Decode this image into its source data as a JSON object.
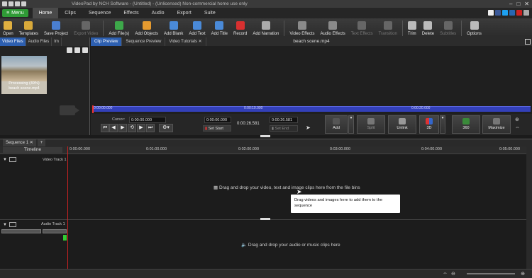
{
  "window": {
    "title": "VideoPad by NCH Software - (Untitled) - (Unlicensed) Non-commercial home use only",
    "controls": [
      "–",
      "□",
      "✕"
    ]
  },
  "ribbon": {
    "menu_label": "Menu",
    "tabs": [
      "Home",
      "Clips",
      "Sequence",
      "Effects",
      "Audio",
      "Export",
      "Suite"
    ],
    "active_tab": "Home"
  },
  "toolbar": {
    "items": [
      {
        "label": "Open",
        "icon": "folder-icon",
        "color": "#e0b040",
        "enabled": true
      },
      {
        "label": "Templates",
        "icon": "templates-icon",
        "color": "#d8a93a",
        "enabled": true
      },
      {
        "label": "Save Project",
        "icon": "save-icon",
        "color": "#4a7fd0",
        "enabled": true
      },
      {
        "label": "Export Video",
        "icon": "export-video-icon",
        "color": "#666666",
        "enabled": false
      },
      {
        "label": "Add File(s)",
        "icon": "add-file-icon",
        "color": "#3da84a",
        "enabled": true
      },
      {
        "label": "Add Objects",
        "icon": "add-objects-icon",
        "color": "#e59a2f",
        "enabled": true
      },
      {
        "label": "Add Blank",
        "icon": "add-blank-icon",
        "color": "#4a8ad8",
        "enabled": true
      },
      {
        "label": "Add Text",
        "icon": "add-text-icon",
        "color": "#4a8ad8",
        "enabled": true
      },
      {
        "label": "Add Title",
        "icon": "add-title-icon",
        "color": "#4a8ad8",
        "enabled": true
      },
      {
        "label": "Record",
        "icon": "record-icon",
        "color": "#d83030",
        "enabled": true
      },
      {
        "label": "Add Narration",
        "icon": "narration-icon",
        "color": "#aaaaaa",
        "enabled": true
      },
      {
        "label": "Video Effects",
        "icon": "video-effects-icon",
        "color": "#8a8a8a",
        "enabled": true
      },
      {
        "label": "Audio Effects",
        "icon": "audio-effects-icon",
        "color": "#8a8a8a",
        "enabled": true
      },
      {
        "label": "Text Effects",
        "icon": "text-effects-icon",
        "color": "#666666",
        "enabled": false
      },
      {
        "label": "Transition",
        "icon": "transition-icon",
        "color": "#666666",
        "enabled": false
      },
      {
        "label": "Trim",
        "icon": "trim-icon",
        "color": "#bbbbbb",
        "enabled": true
      },
      {
        "label": "Delete",
        "icon": "delete-icon",
        "color": "#bbbbbb",
        "enabled": true
      },
      {
        "label": "Subtitles",
        "icon": "subtitles-icon",
        "color": "#666666",
        "enabled": false
      },
      {
        "label": "Options",
        "icon": "options-icon",
        "color": "#bbbbbb",
        "enabled": true
      }
    ]
  },
  "bins": {
    "tabs": [
      "Video Files",
      "Audio Files",
      "Im"
    ],
    "active_tab": "Video Files",
    "clip": {
      "status": "Processing (49%)",
      "name": "beach scene.mp4"
    }
  },
  "preview": {
    "tabs": [
      "Clip Preview",
      "Sequence Preview",
      "Video Tutorials"
    ],
    "active_tab": "Clip Preview",
    "filename": "beach scene.mp4",
    "scrub_ticks": [
      "0:00:00.000",
      "0:00:10.000",
      "0:00:20.000"
    ],
    "cursor_label": "Cursor:",
    "cursor_value": "0:00:00.000",
    "start_value": "0:00:00.000",
    "duration": "0:00:26.581",
    "end_value": "0:00:26.581",
    "set_start": "Set Start",
    "set_end": "Set End",
    "buttons": [
      "Add",
      "Split",
      "Unlink",
      "3D",
      "360",
      "Maximize"
    ]
  },
  "sequence": {
    "tab": "Sequence 1",
    "timeline_label": "Timeline",
    "ruler_ticks": [
      "0:00:00.000",
      "0:01:00.000",
      "0:02:00.000",
      "0:03:00.000",
      "0:04:00.000",
      "0:05:00.000"
    ],
    "video_track": "Video Track 1",
    "audio_track": "Audio Track 1",
    "video_hint": "Drag and drop your video, text and image clips here from the file bins",
    "audio_hint": "Drag and drop your audio or music clips here",
    "tooltip": "Drag videos and images here to add them to the sequence"
  }
}
